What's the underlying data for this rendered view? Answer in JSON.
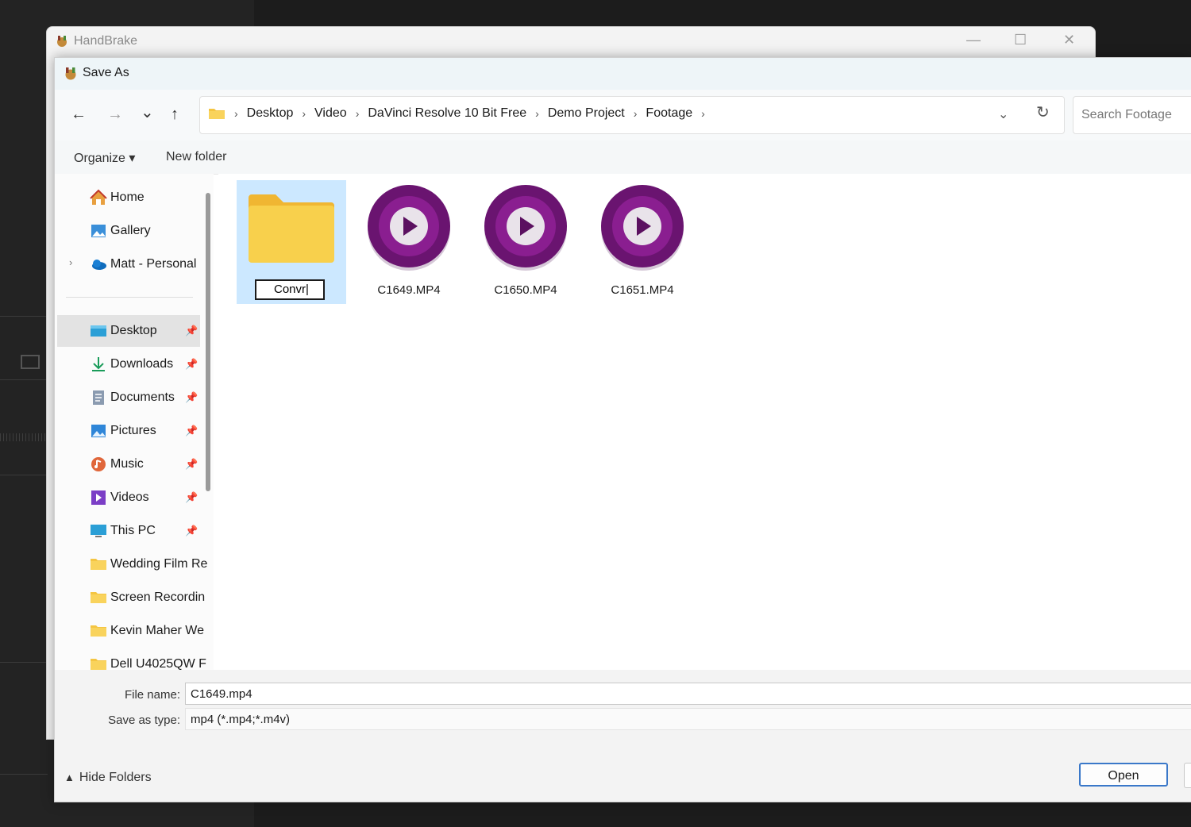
{
  "handbrake": {
    "title": "HandBrake",
    "minimize": "—",
    "maximize": "☐",
    "close": "✕"
  },
  "dialog": {
    "title": "Save As"
  },
  "nav": {
    "back": "←",
    "forward": "→",
    "recent": "⌄",
    "up": "↑"
  },
  "address": {
    "crumbs": [
      "Desktop",
      "Video",
      "DaVinci Resolve 10 Bit Free",
      "Demo Project",
      "Footage"
    ],
    "dropdown": "⌄",
    "refresh": "↻"
  },
  "search": {
    "placeholder": "Search Footage"
  },
  "commandbar": {
    "organize": "Organize ▾",
    "new_folder": "New folder"
  },
  "sidebar": {
    "items": [
      {
        "label": "Home",
        "icon": "home-icon"
      },
      {
        "label": "Gallery",
        "icon": "gallery-icon"
      },
      {
        "label": "Matt - Personal",
        "icon": "onedrive-icon"
      },
      {
        "label": "Desktop",
        "icon": "desktop-icon"
      },
      {
        "label": "Downloads",
        "icon": "downloads-icon"
      },
      {
        "label": "Documents",
        "icon": "documents-icon"
      },
      {
        "label": "Pictures",
        "icon": "pictures-icon"
      },
      {
        "label": "Music",
        "icon": "music-icon"
      },
      {
        "label": "Videos",
        "icon": "videos-icon"
      },
      {
        "label": "This PC",
        "icon": "pc-icon"
      },
      {
        "label": "Wedding Film Re",
        "icon": "folder-icon"
      },
      {
        "label": "Screen Recordin",
        "icon": "folder-icon"
      },
      {
        "label": "Kevin Maher We",
        "icon": "folder-icon"
      },
      {
        "label": "Dell U4025QW F",
        "icon": "folder-icon"
      }
    ],
    "chevron": "›",
    "pin": "📌"
  },
  "files": [
    {
      "name": "Convr",
      "type": "folder",
      "renaming": true
    },
    {
      "name": "C1649.MP4",
      "type": "video"
    },
    {
      "name": "C1650.MP4",
      "type": "video"
    },
    {
      "name": "C1651.MP4",
      "type": "video"
    }
  ],
  "bottom": {
    "file_name_label": "File name:",
    "file_name_value": "C1649.mp4",
    "save_type_label": "Save as type:",
    "save_type_value": "mp4 (*.mp4;*.m4v)",
    "hide_folders": "Hide Folders",
    "open_button": "Open"
  },
  "colors": {
    "accent": "#3a78c9",
    "selection": "#cce8ff",
    "video_icon": "#6a1470"
  }
}
